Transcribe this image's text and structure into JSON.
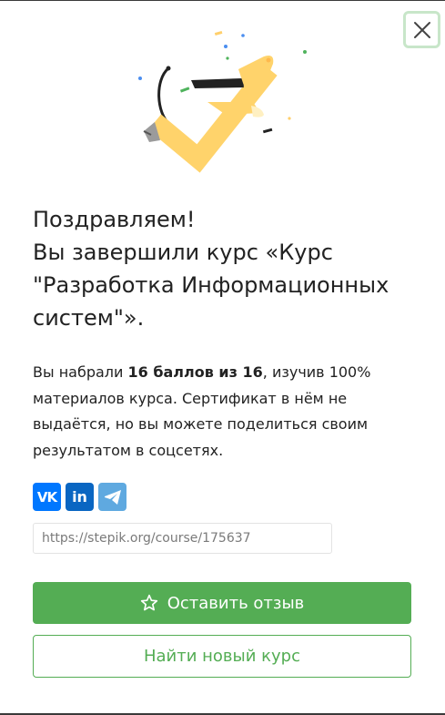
{
  "title_lines": [
    "Поздравляем!",
    "Вы завершили курс «Курс",
    "\"Разработка Информационных",
    "систем\"»."
  ],
  "description": {
    "prefix": "Вы набрали ",
    "score": "16 баллов из 16",
    "suffix": ", изучив 100% материалов курса. Сертификат в нём не выдаётся, но вы можете поделиться своим результатом в соцсетях."
  },
  "share": {
    "vk_label": "VK",
    "linkedin_label": "in",
    "link_value": "https://stepik.org/course/175637"
  },
  "buttons": {
    "review_label": "Оставить отзыв",
    "find_label": "Найти новый курс"
  },
  "colors": {
    "primary": "#54ad54",
    "vk": "#0077ff",
    "linkedin": "#0a66c2",
    "telegram": "#5fa9e0",
    "close_border": "#c8e6c9",
    "checkmark": "#ffd36b"
  },
  "icons": [
    "close-icon",
    "checkmark-illustration",
    "vk-icon",
    "linkedin-icon",
    "telegram-icon",
    "star-icon"
  ]
}
